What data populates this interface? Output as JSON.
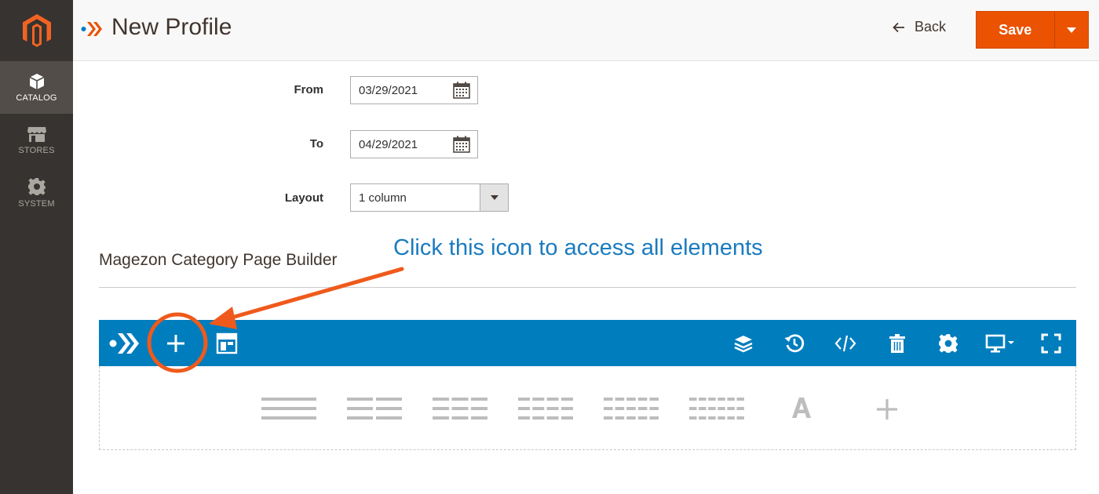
{
  "sidebar": {
    "items": [
      {
        "label": "CATALOG",
        "icon": "box-icon",
        "active": true
      },
      {
        "label": "STORES",
        "icon": "store-icon",
        "active": false
      },
      {
        "label": "SYSTEM",
        "icon": "gear-icon",
        "active": false
      }
    ]
  },
  "header": {
    "title": "New Profile",
    "back_label": "Back",
    "save_label": "Save"
  },
  "form": {
    "from": {
      "label": "From",
      "value": "03/29/2021"
    },
    "to": {
      "label": "To",
      "value": "04/29/2021"
    },
    "layout": {
      "label": "Layout",
      "value": "1 column"
    }
  },
  "builder": {
    "title": "Magezon Category Page Builder",
    "toolbar_icons_left": [
      "magezon-logo-icon",
      "add-element-icon",
      "templates-icon"
    ],
    "toolbar_icons_right": [
      "layers-icon",
      "history-icon",
      "code-icon",
      "trash-icon",
      "settings-icon",
      "desktop-view-icon",
      "fullscreen-icon"
    ],
    "row_layouts": [
      "1-column",
      "2-columns",
      "3-columns",
      "4-columns",
      "5-columns",
      "6-columns",
      "text-block",
      "add"
    ]
  },
  "annotation": {
    "text": "Click this icon to access all elements"
  },
  "colors": {
    "sidebar": "#373330",
    "accent": "#eb5202",
    "toolbar": "#007dbd",
    "annotation_text": "#1a7bbf"
  }
}
